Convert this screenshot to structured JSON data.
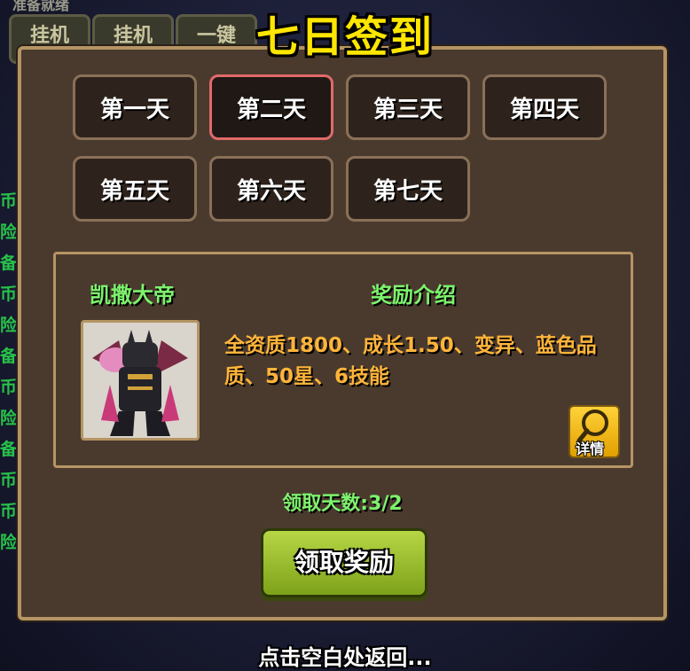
{
  "background": {
    "top_label": "准备就绪",
    "tabs": [
      "挂机",
      "挂机",
      "一键"
    ],
    "side_text": [
      "币",
      "险",
      "备",
      "币",
      "险",
      "备",
      "币",
      "险",
      "备",
      "币",
      "币",
      "险"
    ]
  },
  "title": "七日签到",
  "days": [
    {
      "label": "第一天",
      "selected": false
    },
    {
      "label": "第二天",
      "selected": true
    },
    {
      "label": "第三天",
      "selected": false
    },
    {
      "label": "第四天",
      "selected": false
    },
    {
      "label": "第五天",
      "selected": false
    },
    {
      "label": "第六天",
      "selected": false
    },
    {
      "label": "第七天",
      "selected": false
    }
  ],
  "reward": {
    "hero_name": "凯撒大帝",
    "section_title": "奖励介绍",
    "description": "全资质1800、成长1.50、变异、蓝色品质、50星、6技能",
    "detail_label": "详情"
  },
  "claim_count": "领取天数:3/2",
  "claim_button": "领取奖励",
  "hint": "点击空白处返回...",
  "colors": {
    "title": "#ffe600",
    "green_text": "#7df26d",
    "orange_text": "#ffb43a",
    "panel": "#4a3a2e",
    "border": "#b59564",
    "selected_border": "#e06a6a",
    "claim_button": "#9cc22e"
  }
}
